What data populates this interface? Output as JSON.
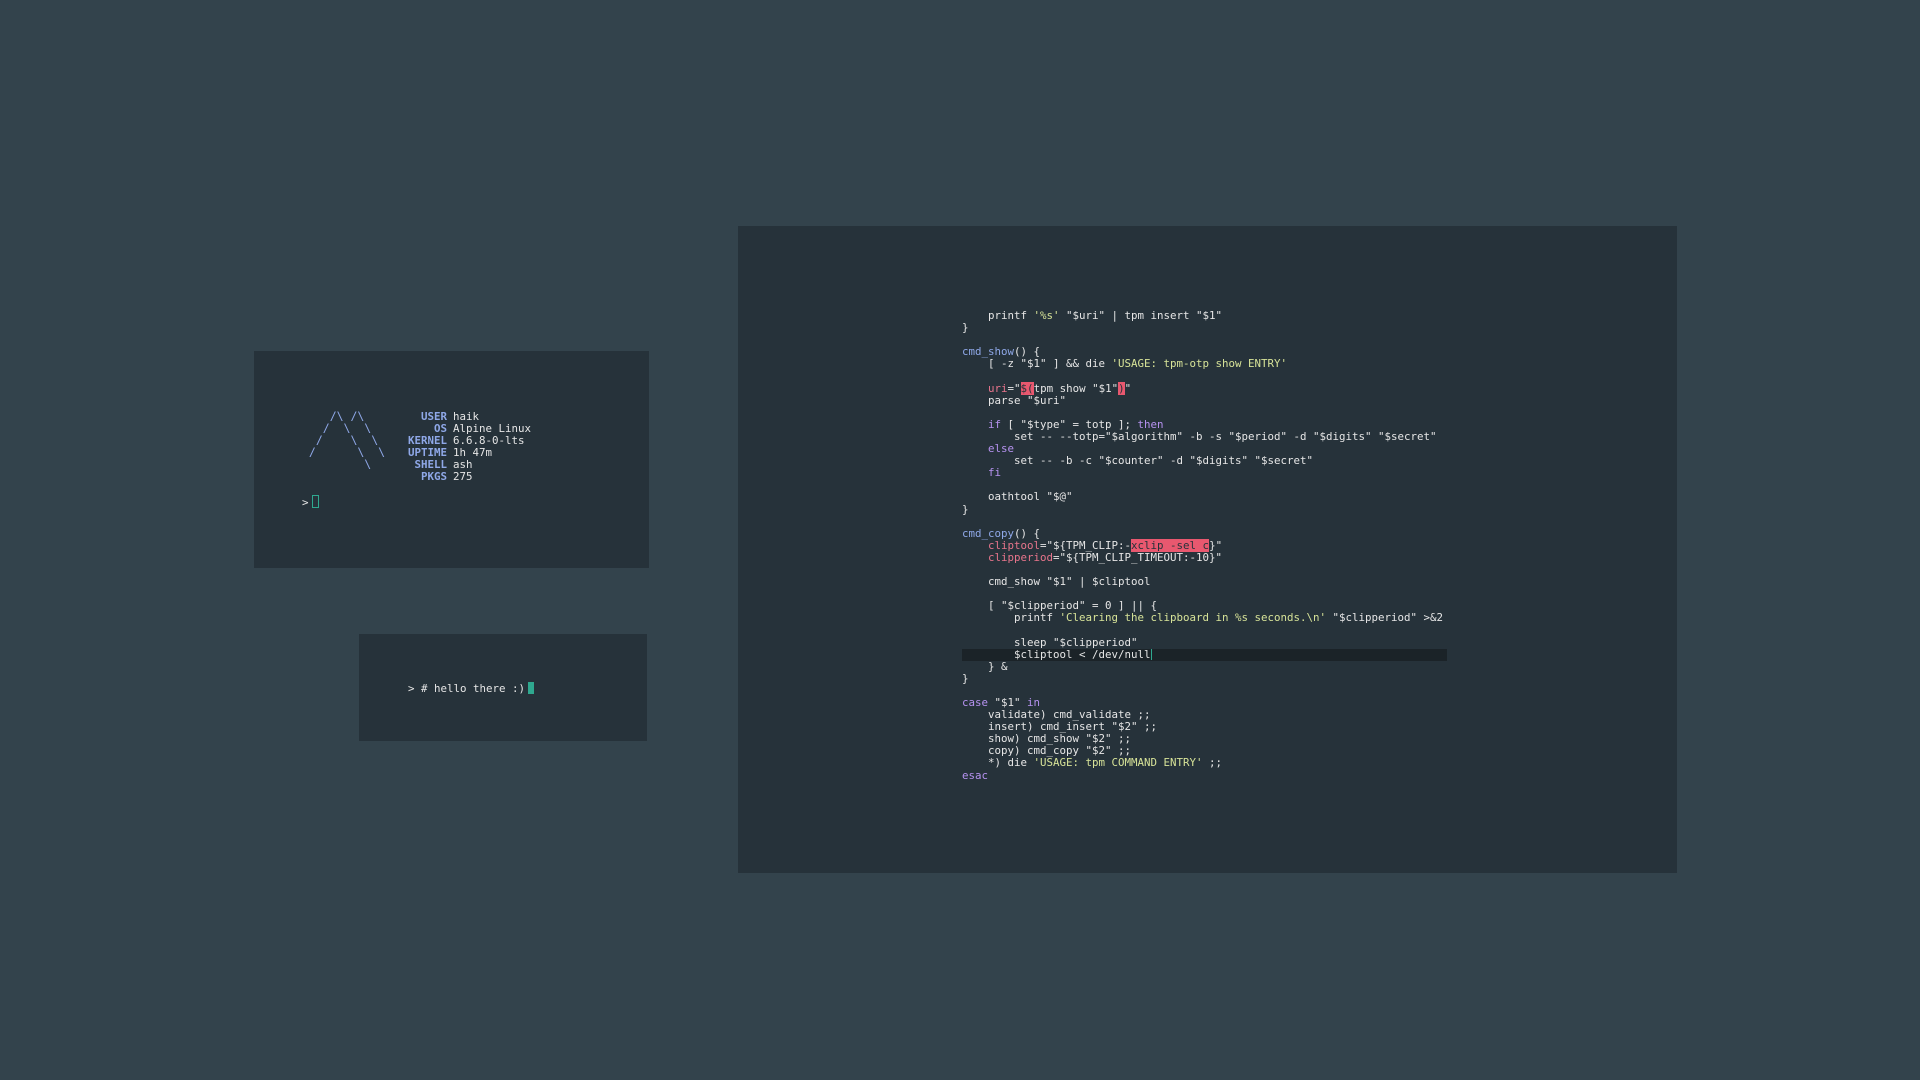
{
  "fetch_terminal": {
    "logo_lines": [
      "    /\\ /\\",
      "   /  \\  \\",
      "  /    \\  \\",
      " /      \\  \\",
      "         \\"
    ],
    "info": [
      {
        "key": "USER",
        "value": "haik"
      },
      {
        "key": "OS",
        "value": "Alpine Linux"
      },
      {
        "key": "KERNEL",
        "value": "6.6.8-0-lts"
      },
      {
        "key": "UPTIME",
        "value": "1h 47m"
      },
      {
        "key": "SHELL",
        "value": "ash"
      },
      {
        "key": "PKGS",
        "value": "275"
      }
    ],
    "prompt": ">"
  },
  "hello_terminal": {
    "prompt": "> # hello there :)"
  },
  "code_terminal": {
    "lines": [
      [
        {
          "t": "    printf ",
          "c": "fg"
        },
        {
          "t": "'%s'",
          "c": "str"
        },
        {
          "t": " \"$uri\" | tpm insert \"$1\"",
          "c": "fg"
        }
      ],
      [
        {
          "t": "}",
          "c": "fg"
        }
      ],
      [
        {
          "t": "",
          "c": "fg"
        }
      ],
      [
        {
          "t": "cmd_show",
          "c": "fn"
        },
        {
          "t": "() {",
          "c": "fg"
        }
      ],
      [
        {
          "t": "    [ -z \"$1\" ] && die ",
          "c": "fg"
        },
        {
          "t": "'USAGE: tpm-otp show ENTRY'",
          "c": "str"
        }
      ],
      [
        {
          "t": "",
          "c": "fg"
        }
      ],
      [
        {
          "t": "    ",
          "c": "fg"
        },
        {
          "t": "uri",
          "c": "var"
        },
        {
          "t": "=\"",
          "c": "fg"
        },
        {
          "t": "$(",
          "c": "sel"
        },
        {
          "t": "tpm show \"$1\"",
          "c": "fg"
        },
        {
          "t": ")",
          "c": "sel"
        },
        {
          "t": "\"",
          "c": "fg"
        }
      ],
      [
        {
          "t": "    parse \"$uri\"",
          "c": "fg"
        }
      ],
      [
        {
          "t": "",
          "c": "fg"
        }
      ],
      [
        {
          "t": "    ",
          "c": "fg"
        },
        {
          "t": "if",
          "c": "kw"
        },
        {
          "t": " [ \"$type\" = totp ]; ",
          "c": "fg"
        },
        {
          "t": "then",
          "c": "kw"
        }
      ],
      [
        {
          "t": "        set -- --totp=\"$algorithm\" -b -s \"$period\" -d \"$digits\" \"$secret\"",
          "c": "fg"
        }
      ],
      [
        {
          "t": "    ",
          "c": "fg"
        },
        {
          "t": "else",
          "c": "kw"
        }
      ],
      [
        {
          "t": "        set -- -b -c \"$counter\" -d \"$digits\" \"$secret\"",
          "c": "fg"
        }
      ],
      [
        {
          "t": "    ",
          "c": "fg"
        },
        {
          "t": "fi",
          "c": "kw"
        }
      ],
      [
        {
          "t": "",
          "c": "fg"
        }
      ],
      [
        {
          "t": "    oathtool \"$@\"",
          "c": "fg"
        }
      ],
      [
        {
          "t": "}",
          "c": "fg"
        }
      ],
      [
        {
          "t": "",
          "c": "fg"
        }
      ],
      [
        {
          "t": "cmd_copy",
          "c": "fn"
        },
        {
          "t": "() {",
          "c": "fg"
        }
      ],
      [
        {
          "t": "    ",
          "c": "fg"
        },
        {
          "t": "cliptool",
          "c": "var"
        },
        {
          "t": "=\"${TPM_CLIP:-",
          "c": "fg"
        },
        {
          "t": "xclip -sel c",
          "c": "sel"
        },
        {
          "t": "}\"",
          "c": "fg"
        }
      ],
      [
        {
          "t": "    ",
          "c": "fg"
        },
        {
          "t": "clipperiod",
          "c": "var"
        },
        {
          "t": "=\"${TPM_CLIP_TIMEOUT:-10}\"",
          "c": "fg"
        }
      ],
      [
        {
          "t": "",
          "c": "fg"
        }
      ],
      [
        {
          "t": "    cmd_show \"$1\" | $cliptool",
          "c": "fg"
        }
      ],
      [
        {
          "t": "",
          "c": "fg"
        }
      ],
      [
        {
          "t": "    [ \"$clipperiod\" = 0 ] || {",
          "c": "fg"
        }
      ],
      [
        {
          "t": "        printf ",
          "c": "fg"
        },
        {
          "t": "'Clearing the clipboard in %s seconds.\\n'",
          "c": "str"
        },
        {
          "t": " \"$clipperiod\" >&2",
          "c": "fg"
        }
      ],
      [
        {
          "t": "",
          "c": "fg"
        }
      ],
      [
        {
          "t": "        sleep \"$clipperiod\"",
          "c": "fg"
        }
      ],
      [
        {
          "t": "        $cliptool < /dev/null",
          "c": "fg"
        }
      ],
      [
        {
          "t": "    } &",
          "c": "fg"
        }
      ],
      [
        {
          "t": "}",
          "c": "fg"
        }
      ],
      [
        {
          "t": "",
          "c": "fg"
        }
      ],
      [
        {
          "t": "case",
          "c": "kw"
        },
        {
          "t": " \"$1\" ",
          "c": "fg"
        },
        {
          "t": "in",
          "c": "kw"
        }
      ],
      [
        {
          "t": "    validate) cmd_validate ;;",
          "c": "fg"
        }
      ],
      [
        {
          "t": "    insert) cmd_insert \"$2\" ;;",
          "c": "fg"
        }
      ],
      [
        {
          "t": "    show) cmd_show \"$2\" ;;",
          "c": "fg"
        }
      ],
      [
        {
          "t": "    copy) cmd_copy \"$2\" ;;",
          "c": "fg"
        }
      ],
      [
        {
          "t": "    *) die ",
          "c": "fg"
        },
        {
          "t": "'USAGE: tpm COMMAND ENTRY'",
          "c": "str"
        },
        {
          "t": " ;;",
          "c": "fg"
        }
      ],
      [
        {
          "t": "esac",
          "c": "kw"
        }
      ]
    ],
    "current_line_index": 28
  },
  "colors": {
    "desktop": "#33434c",
    "terminal_bg": "#26323a",
    "accent_cursor": "#2fa88f",
    "keyword": "#b692f0",
    "function": "#8fa8e8",
    "string": "#d7e398",
    "variable": "#e8758c",
    "selection": "#e8586f"
  }
}
